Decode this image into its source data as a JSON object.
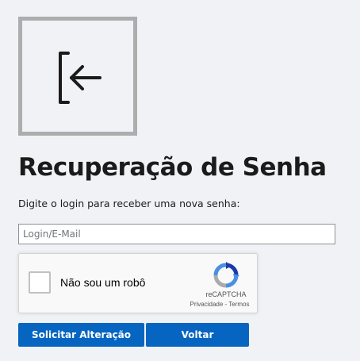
{
  "logo": {
    "icon": "sign-in-arrow-icon",
    "border_color": "#adadad"
  },
  "page": {
    "title": "Recuperação de Senha"
  },
  "form": {
    "instruction": "Digite o login para receber uma nova senha:",
    "login_placeholder": "Login/E-Mail",
    "login_value": ""
  },
  "recaptcha": {
    "label": "Não sou um robô",
    "brand": "reCAPTCHA",
    "privacy_link": "Privacidade",
    "separator": " - ",
    "terms_link": "Termos"
  },
  "actions": {
    "submit_label": "Solicitar Alteração",
    "back_label": "Voltar",
    "button_color": "#0565c1"
  }
}
